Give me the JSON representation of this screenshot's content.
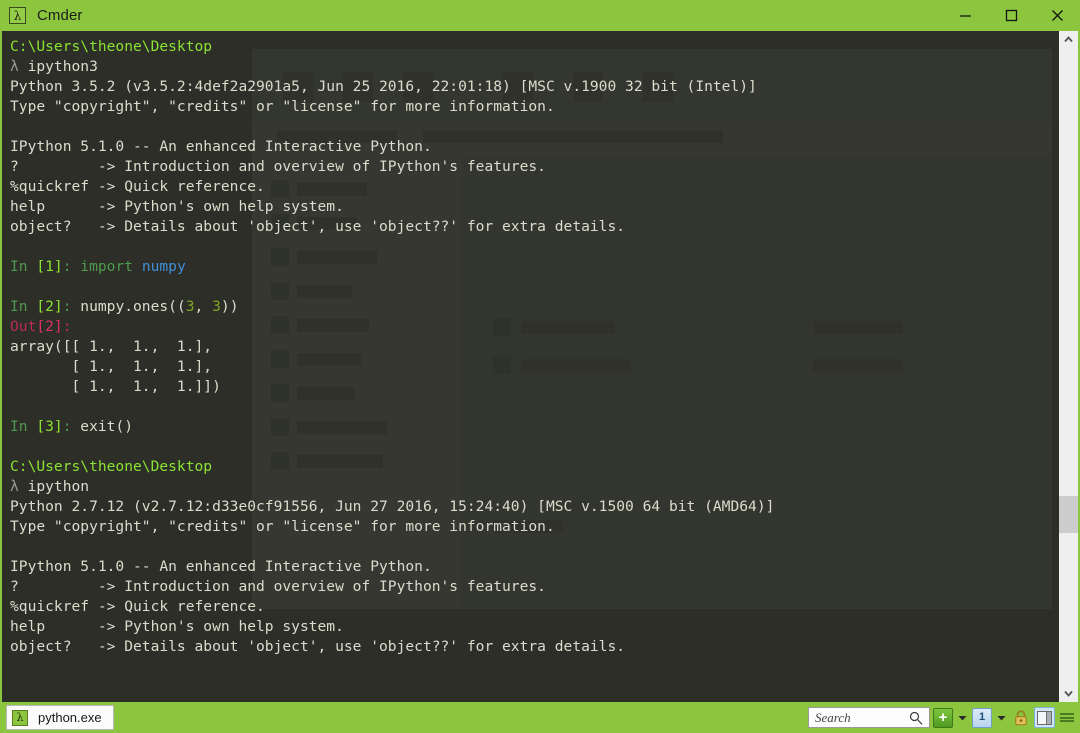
{
  "window": {
    "title": "Cmder",
    "icon": "lambda-icon",
    "accent_color": "#8cc63e",
    "terminal_bg": "#2c2e27",
    "controls": [
      {
        "name": "minimize",
        "glyph": "minimize-icon"
      },
      {
        "name": "maximize",
        "glyph": "maximize-icon"
      },
      {
        "name": "close",
        "glyph": "close-icon"
      }
    ]
  },
  "terminal": {
    "lines": [
      {
        "segments": [
          {
            "text": "C:\\Users\\theone\\Desktop",
            "class": "c-path"
          }
        ]
      },
      {
        "segments": [
          {
            "text": "λ ",
            "class": "c-lambda"
          },
          {
            "text": "ipython3",
            "class": "c-white"
          }
        ]
      },
      {
        "segments": [
          {
            "text": "Python 3.5.2 (v3.5.2:4def2a2901a5, Jun 25 2016, 22:01:18) [MSC v.1900 32 bit (Intel)]",
            "class": "c-white"
          }
        ]
      },
      {
        "segments": [
          {
            "text": "Type \"copyright\", \"credits\" or \"license\" for more information.",
            "class": "c-white"
          }
        ]
      },
      {
        "segments": [
          {
            "text": "",
            "class": "c-white"
          }
        ]
      },
      {
        "segments": [
          {
            "text": "IPython 5.1.0 -- An enhanced Interactive Python.",
            "class": "c-white"
          }
        ]
      },
      {
        "segments": [
          {
            "text": "?         -> Introduction and overview of IPython's features.",
            "class": "c-white"
          }
        ]
      },
      {
        "segments": [
          {
            "text": "%quickref -> Quick reference.",
            "class": "c-white"
          }
        ]
      },
      {
        "segments": [
          {
            "text": "help      -> Python's own help system.",
            "class": "c-white"
          }
        ]
      },
      {
        "segments": [
          {
            "text": "object?   -> Details about 'object', use 'object??' for extra details.",
            "class": "c-white"
          }
        ]
      },
      {
        "segments": [
          {
            "text": "",
            "class": "c-white"
          }
        ]
      },
      {
        "segments": [
          {
            "text": "In ",
            "class": "c-in"
          },
          {
            "text": "[1]",
            "class": "c-innum"
          },
          {
            "text": ": ",
            "class": "c-in"
          },
          {
            "text": "import",
            "class": "c-kw"
          },
          {
            "text": " ",
            "class": "c-white"
          },
          {
            "text": "numpy",
            "class": "c-mod"
          }
        ]
      },
      {
        "segments": [
          {
            "text": "",
            "class": "c-white"
          }
        ]
      },
      {
        "segments": [
          {
            "text": "In ",
            "class": "c-in"
          },
          {
            "text": "[2]",
            "class": "c-innum"
          },
          {
            "text": ": ",
            "class": "c-in"
          },
          {
            "text": "numpy.ones((",
            "class": "c-white"
          },
          {
            "text": "3",
            "class": "c-num"
          },
          {
            "text": ", ",
            "class": "c-white"
          },
          {
            "text": "3",
            "class": "c-num"
          },
          {
            "text": "))",
            "class": "c-white"
          }
        ]
      },
      {
        "segments": [
          {
            "text": "Out",
            "class": "c-out"
          },
          {
            "text": "[2]",
            "class": "c-outnum"
          },
          {
            "text": ": ",
            "class": "c-out"
          }
        ]
      },
      {
        "segments": [
          {
            "text": "array([[ 1.,  1.,  1.],",
            "class": "c-white"
          }
        ]
      },
      {
        "segments": [
          {
            "text": "       [ 1.,  1.,  1.],",
            "class": "c-white"
          }
        ]
      },
      {
        "segments": [
          {
            "text": "       [ 1.,  1.,  1.]])",
            "class": "c-white"
          }
        ]
      },
      {
        "segments": [
          {
            "text": "",
            "class": "c-white"
          }
        ]
      },
      {
        "segments": [
          {
            "text": "In ",
            "class": "c-in"
          },
          {
            "text": "[3]",
            "class": "c-innum"
          },
          {
            "text": ": ",
            "class": "c-in"
          },
          {
            "text": "exit()",
            "class": "c-white"
          }
        ]
      },
      {
        "segments": [
          {
            "text": "",
            "class": "c-white"
          }
        ]
      },
      {
        "segments": [
          {
            "text": "C:\\Users\\theone\\Desktop",
            "class": "c-path"
          }
        ]
      },
      {
        "segments": [
          {
            "text": "λ ",
            "class": "c-lambda"
          },
          {
            "text": "ipython",
            "class": "c-white"
          }
        ]
      },
      {
        "segments": [
          {
            "text": "Python 2.7.12 (v2.7.12:d33e0cf91556, Jun 27 2016, 15:24:40) [MSC v.1500 64 bit (AMD64)]",
            "class": "c-white"
          }
        ]
      },
      {
        "segments": [
          {
            "text": "Type \"copyright\", \"credits\" or \"license\" for more information.",
            "class": "c-white"
          }
        ]
      },
      {
        "segments": [
          {
            "text": "",
            "class": "c-white"
          }
        ]
      },
      {
        "segments": [
          {
            "text": "IPython 5.1.0 -- An enhanced Interactive Python.",
            "class": "c-white"
          }
        ]
      },
      {
        "segments": [
          {
            "text": "?         -> Introduction and overview of IPython's features.",
            "class": "c-white"
          }
        ]
      },
      {
        "segments": [
          {
            "text": "%quickref -> Quick reference.",
            "class": "c-white"
          }
        ]
      },
      {
        "segments": [
          {
            "text": "help      -> Python's own help system.",
            "class": "c-white"
          }
        ]
      },
      {
        "segments": [
          {
            "text": "object?   -> Details about 'object', use 'object??' for extra details.",
            "class": "c-white"
          }
        ]
      }
    ]
  },
  "scrollbar": {
    "up_arrow": "chevron-up-icon",
    "down_arrow": "chevron-down-icon"
  },
  "statusbar": {
    "tab": {
      "label": "python.exe",
      "icon": "lambda-icon"
    },
    "search": {
      "placeholder": "Search",
      "value": "",
      "icon": "search-icon"
    },
    "new_tab": {
      "label": "+",
      "icon": "plus-icon"
    },
    "new_tab_caret": "caret-down-icon",
    "page_count": {
      "label": "1",
      "icon": "tab-count-icon"
    },
    "page_caret": "caret-down-icon",
    "lock": "lock-icon",
    "split": "split-panes-icon",
    "menu": "hamburger-menu-icon"
  }
}
